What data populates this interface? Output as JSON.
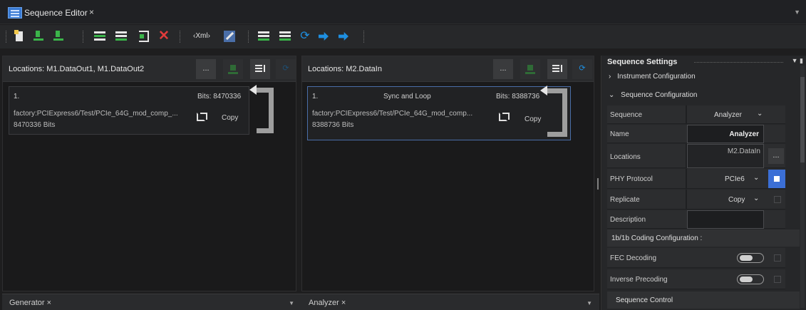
{
  "window": {
    "title": "Sequence Editor",
    "close": "×"
  },
  "toolbar": {
    "xml_label": "‹Xml›"
  },
  "generator": {
    "locations_label": "Locations: M1.DataOut1, M1.DataOut2",
    "more_label": "...",
    "sequence": {
      "index": "1.",
      "bits": "Bits: 8470336",
      "path": "factory:PCIExpress6/Test/PCIe_64G_mod_comp_...",
      "size": "8470336 Bits",
      "copy": "Copy"
    },
    "tab_label": "Generator  ×"
  },
  "analyzer": {
    "locations_label": "Locations: M2.DataIn",
    "more_label": "...",
    "sequence": {
      "index": "1.",
      "loop_label": "Sync and Loop",
      "bits": "Bits: 8388736",
      "path": "factory:PCIExpress6/Test/PCIe_64G_mod_comp...",
      "size": "8388736 Bits",
      "copy": "Copy"
    },
    "tab_label": "Analyzer  ×"
  },
  "settings": {
    "title": "Sequence Settings",
    "instrument_config": "Instrument Configuration",
    "sequence_config": "Sequence Configuration",
    "rows": {
      "sequence": {
        "label": "Sequence",
        "value": "Analyzer"
      },
      "name": {
        "label": "Name",
        "value": "Analyzer"
      },
      "locations": {
        "label": "Locations",
        "value": "M2.DataIn",
        "more": "..."
      },
      "phy": {
        "label": "PHY Protocol",
        "value": "PCIe6"
      },
      "replicate": {
        "label": "Replicate",
        "value": "Copy"
      },
      "description": {
        "label": "Description",
        "value": ""
      }
    },
    "coding_section": "1b/1b Coding Configuration :",
    "fec": "FEC Decoding",
    "inverse": "Inverse Precoding",
    "control_section": "Sequence Control"
  },
  "colors": {
    "accent": "#3b6fd6",
    "download_green": "#3bb54a",
    "delete_red": "#e23b3b",
    "move_blue": "#1e8fe0"
  }
}
